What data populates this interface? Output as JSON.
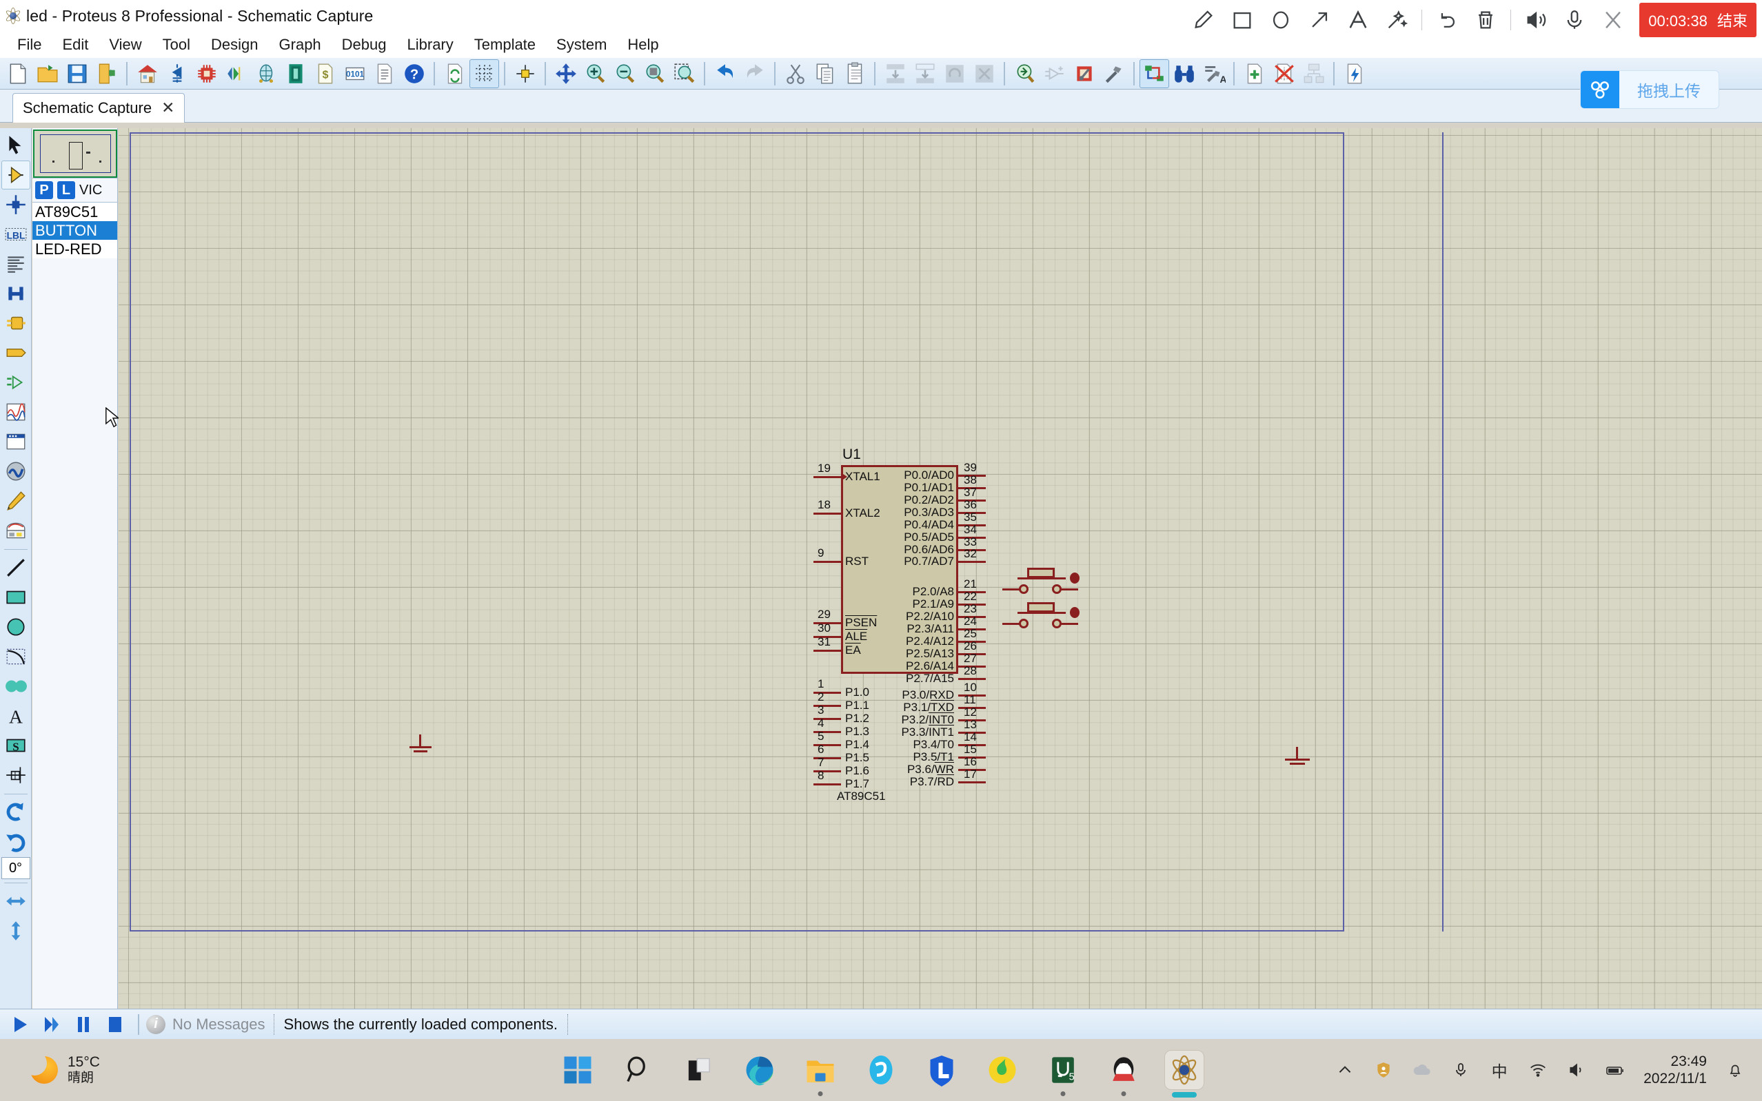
{
  "window": {
    "title": "led - Proteus 8 Professional - Schematic Capture",
    "app_icon": "proteus-atom-icon"
  },
  "menubar": {
    "items": [
      {
        "label": "File"
      },
      {
        "label": "Edit"
      },
      {
        "label": "View"
      },
      {
        "label": "Tool"
      },
      {
        "label": "Design"
      },
      {
        "label": "Graph"
      },
      {
        "label": "Debug"
      },
      {
        "label": "Library"
      },
      {
        "label": "Template"
      },
      {
        "label": "System"
      },
      {
        "label": "Help"
      }
    ]
  },
  "recorder": {
    "tools": [
      {
        "icon": "pen-icon",
        "name": "pen-tool"
      },
      {
        "icon": "rectangle-icon",
        "name": "rectangle-tool"
      },
      {
        "icon": "ellipse-icon",
        "name": "ellipse-tool"
      },
      {
        "icon": "arrow-icon",
        "name": "arrow-tool"
      },
      {
        "icon": "text-icon",
        "name": "text-tool"
      },
      {
        "icon": "magic-wand-icon",
        "name": "highlight-tool"
      },
      {
        "icon": "undo-icon",
        "name": "undo-annotation"
      },
      {
        "icon": "trash-icon",
        "name": "clear-annotations"
      },
      {
        "icon": "speaker-icon",
        "name": "system-audio-toggle"
      },
      {
        "icon": "microphone-icon",
        "name": "microphone-toggle"
      },
      {
        "icon": "close-icon",
        "name": "close-recorder"
      }
    ],
    "timer": "00:03:38",
    "stop_label": "结束"
  },
  "cloud_upload": {
    "icon": "baidu-netdisk-icon",
    "label": "拖拽上传"
  },
  "toolbar": {
    "groups": [
      {
        "buttons": [
          {
            "name": "new-project-button",
            "icon": "new-file-icon",
            "state": "enabled"
          },
          {
            "name": "open-project-button",
            "icon": "open-folder-icon",
            "state": "enabled"
          },
          {
            "name": "save-project-button",
            "icon": "floppy-save-icon",
            "state": "enabled"
          },
          {
            "name": "import-export-button",
            "icon": "door-export-icon",
            "state": "enabled"
          }
        ]
      },
      {
        "buttons": [
          {
            "name": "home-page-button",
            "icon": "house-icon",
            "state": "enabled"
          },
          {
            "name": "schematic-capture-button",
            "icon": "diode-schematic-icon",
            "state": "enabled"
          },
          {
            "name": "pcb-layout-button",
            "icon": "chip-pcb-icon",
            "state": "enabled"
          },
          {
            "name": "3d-visualizer-button",
            "icon": "3d-view-icon",
            "state": "enabled"
          },
          {
            "name": "source-code-button",
            "icon": "green-document-icon",
            "state": "enabled"
          },
          {
            "name": "bill-of-materials-button",
            "icon": "dollar-document-icon",
            "state": "enabled"
          },
          {
            "name": "bom-binary-button",
            "icon": "binary-0101-icon",
            "state": "enabled"
          },
          {
            "name": "report-button",
            "icon": "report-document-icon",
            "state": "enabled"
          },
          {
            "name": "help-button",
            "icon": "question-mark-icon",
            "state": "enabled"
          }
        ]
      },
      {
        "buttons": [
          {
            "name": "refresh-button",
            "icon": "refresh-arrows-icon",
            "state": "enabled"
          },
          {
            "name": "toggle-grid-button",
            "icon": "grid-dots-icon",
            "state": "active"
          },
          {
            "name": "set-origin-button",
            "icon": "origin-crosshair-icon",
            "state": "enabled"
          }
        ]
      },
      {
        "buttons": [
          {
            "name": "pan-button",
            "icon": "four-way-arrows-icon",
            "state": "enabled"
          },
          {
            "name": "zoom-in-button",
            "icon": "magnifier-plus-icon",
            "state": "enabled"
          },
          {
            "name": "zoom-out-button",
            "icon": "magnifier-minus-icon",
            "state": "enabled"
          },
          {
            "name": "zoom-to-fit-button",
            "icon": "magnifier-fit-icon",
            "state": "enabled"
          },
          {
            "name": "zoom-to-area-button",
            "icon": "magnifier-area-icon",
            "state": "enabled"
          }
        ]
      },
      {
        "buttons": [
          {
            "name": "undo-button",
            "icon": "undo-arrow-icon",
            "state": "enabled"
          },
          {
            "name": "redo-button",
            "icon": "redo-arrow-icon",
            "state": "disabled"
          }
        ]
      },
      {
        "buttons": [
          {
            "name": "cut-button",
            "icon": "scissors-icon",
            "state": "enabled"
          },
          {
            "name": "copy-button",
            "icon": "copy-pages-icon",
            "state": "enabled"
          },
          {
            "name": "paste-button",
            "icon": "clipboard-icon",
            "state": "enabled"
          }
        ]
      },
      {
        "buttons": [
          {
            "name": "block-copy-button",
            "icon": "block-copy-icon",
            "state": "disabled"
          },
          {
            "name": "block-move-button",
            "icon": "block-move-icon",
            "state": "disabled"
          },
          {
            "name": "block-rotate-button",
            "icon": "block-rotate-icon",
            "state": "disabled"
          },
          {
            "name": "block-delete-button",
            "icon": "block-delete-icon",
            "state": "disabled"
          }
        ]
      },
      {
        "buttons": [
          {
            "name": "pick-from-library-button",
            "icon": "library-pick-icon",
            "state": "enabled"
          },
          {
            "name": "make-device-button",
            "icon": "make-device-icon",
            "state": "disabled"
          },
          {
            "name": "packaging-tool-button",
            "icon": "packaging-wrench-icon",
            "state": "enabled"
          },
          {
            "name": "decompose-button",
            "icon": "hammer-icon",
            "state": "enabled"
          }
        ]
      },
      {
        "buttons": [
          {
            "name": "wire-autorouter-button",
            "icon": "autoroute-icon",
            "state": "active"
          },
          {
            "name": "search-and-tag-button",
            "icon": "binoculars-icon",
            "state": "enabled"
          },
          {
            "name": "property-assignment-button",
            "icon": "property-wrench-a-icon",
            "state": "enabled"
          }
        ]
      },
      {
        "buttons": [
          {
            "name": "new-sheet-button",
            "icon": "new-sheet-plus-icon",
            "state": "enabled"
          },
          {
            "name": "remove-sheet-button",
            "icon": "remove-sheet-x-icon",
            "state": "enabled"
          },
          {
            "name": "goto-sheet-button",
            "icon": "sheet-tree-icon",
            "state": "disabled"
          }
        ]
      },
      {
        "buttons": [
          {
            "name": "energy-analysis-button",
            "icon": "lightning-document-icon",
            "state": "enabled"
          }
        ]
      }
    ]
  },
  "document_tab": {
    "label": "Schematic Capture",
    "close_label": "✕"
  },
  "left_tools": {
    "items": [
      {
        "name": "selection-mode-tool",
        "icon": "arrow-cursor-icon",
        "state": "enabled"
      },
      {
        "name": "component-mode-tool",
        "icon": "yellow-triangle-component-icon",
        "state": "selected"
      },
      {
        "name": "junction-dot-tool",
        "icon": "junction-dot-icon",
        "state": "enabled"
      },
      {
        "name": "wire-label-tool",
        "icon": "lbl-label-icon",
        "state": "enabled"
      },
      {
        "name": "text-script-tool",
        "icon": "text-script-lines-icon",
        "state": "enabled"
      },
      {
        "name": "buses-tool",
        "icon": "bus-icon",
        "state": "enabled"
      },
      {
        "name": "subcircuit-tool",
        "icon": "subcircuit-icon",
        "state": "enabled"
      },
      {
        "name": "terminals-tool",
        "icon": "terminal-tag-icon",
        "state": "enabled"
      },
      {
        "name": "device-pins-tool",
        "icon": "device-pin-icon",
        "state": "enabled"
      },
      {
        "name": "graph-tool",
        "icon": "graph-waveform-icon",
        "state": "enabled"
      },
      {
        "name": "tape-recorder-tool",
        "icon": "tape-recorder-icon",
        "state": "enabled"
      },
      {
        "name": "generator-tool",
        "icon": "sine-generator-icon",
        "state": "enabled"
      },
      {
        "name": "voltage-probe-tool",
        "icon": "probe-pencil-icon",
        "state": "enabled"
      },
      {
        "name": "virtual-instruments-tool",
        "icon": "oscilloscope-icon",
        "state": "enabled"
      },
      {
        "name": "2d-line-tool",
        "icon": "line-icon",
        "state": "enabled"
      },
      {
        "name": "2d-box-tool",
        "icon": "filled-box-icon",
        "state": "enabled"
      },
      {
        "name": "2d-circle-tool",
        "icon": "filled-circle-icon",
        "state": "enabled"
      },
      {
        "name": "2d-arc-tool",
        "icon": "arc-icon",
        "state": "enabled"
      },
      {
        "name": "2d-path-tool",
        "icon": "closed-path-icon",
        "state": "enabled"
      },
      {
        "name": "2d-text-tool",
        "icon": "serif-a-icon",
        "state": "enabled"
      },
      {
        "name": "2d-symbol-tool",
        "icon": "symbol-s-icon",
        "state": "enabled"
      },
      {
        "name": "2d-marker-tool",
        "icon": "marker-crosshair-icon",
        "state": "enabled"
      },
      {
        "name": "rotate-clockwise-button",
        "icon": "rotate-cw-icon",
        "state": "enabled"
      },
      {
        "name": "rotate-counterclockwise-button",
        "icon": "rotate-ccw-icon",
        "state": "enabled"
      },
      {
        "name": "mirror-horizontal-button",
        "icon": "mirror-horizontal-icon",
        "state": "enabled"
      },
      {
        "name": "mirror-vertical-button",
        "icon": "mirror-vertical-icon",
        "state": "enabled"
      }
    ],
    "rotation_value": "0°"
  },
  "object_selector": {
    "buttons": [
      {
        "name": "pick-devices-button",
        "label": "P"
      },
      {
        "name": "library-manager-button",
        "label": "L"
      }
    ],
    "mode_label": "VIC",
    "items": [
      {
        "label": "AT89C51",
        "selected": false
      },
      {
        "label": "BUTTON",
        "selected": true
      },
      {
        "label": "LED-RED",
        "selected": false
      }
    ]
  },
  "schematic": {
    "component": {
      "reference": "U1",
      "device_name": "AT89C51",
      "left_pins": [
        {
          "num": "19",
          "label": "XTAL1",
          "overline": false,
          "clock": true
        },
        {
          "num": "18",
          "label": "XTAL2",
          "overline": false,
          "clock": false
        },
        {
          "num": "9",
          "label": "RST",
          "overline": false,
          "clock": false
        },
        {
          "num": "29",
          "label": "PSEN",
          "overline": true,
          "clock": false
        },
        {
          "num": "30",
          "label": "ALE",
          "overline": true,
          "clock": false
        },
        {
          "num": "31",
          "label": "EA",
          "overline": true,
          "clock": false
        },
        {
          "num": "1",
          "label": "P1.0",
          "overline": false,
          "clock": false
        },
        {
          "num": "2",
          "label": "P1.1",
          "overline": false,
          "clock": false
        },
        {
          "num": "3",
          "label": "P1.2",
          "overline": false,
          "clock": false
        },
        {
          "num": "4",
          "label": "P1.3",
          "overline": false,
          "clock": false
        },
        {
          "num": "5",
          "label": "P1.4",
          "overline": false,
          "clock": false
        },
        {
          "num": "6",
          "label": "P1.5",
          "overline": false,
          "clock": false
        },
        {
          "num": "7",
          "label": "P1.6",
          "overline": false,
          "clock": false
        },
        {
          "num": "8",
          "label": "P1.7",
          "overline": false,
          "clock": false
        }
      ],
      "right_pins": [
        {
          "num": "39",
          "label": "P0.0/AD0"
        },
        {
          "num": "38",
          "label": "P0.1/AD1"
        },
        {
          "num": "37",
          "label": "P0.2/AD2"
        },
        {
          "num": "36",
          "label": "P0.3/AD3"
        },
        {
          "num": "35",
          "label": "P0.4/AD4"
        },
        {
          "num": "34",
          "label": "P0.5/AD5"
        },
        {
          "num": "33",
          "label": "P0.6/AD6"
        },
        {
          "num": "32",
          "label": "P0.7/AD7"
        },
        {
          "num": "21",
          "label": "P2.0/A8"
        },
        {
          "num": "22",
          "label": "P2.1/A9"
        },
        {
          "num": "23",
          "label": "P2.2/A10"
        },
        {
          "num": "24",
          "label": "P2.3/A11"
        },
        {
          "num": "25",
          "label": "P2.4/A12"
        },
        {
          "num": "26",
          "label": "P2.5/A13"
        },
        {
          "num": "27",
          "label": "P2.6/A14"
        },
        {
          "num": "28",
          "label": "P2.7/A15"
        },
        {
          "num": "10",
          "label": "P3.0/RXD"
        },
        {
          "num": "11",
          "label": "P3.1/TXD"
        },
        {
          "num": "12",
          "label": "P3.2/INT0"
        },
        {
          "num": "13",
          "label": "P3.3/INT1"
        },
        {
          "num": "14",
          "label": "P3.4/T0"
        },
        {
          "num": "15",
          "label": "P3.5/T1"
        },
        {
          "num": "16",
          "label": "P3.6/WR"
        },
        {
          "num": "17",
          "label": "P3.7/RD"
        }
      ]
    },
    "placed_symbols": [
      {
        "name": "button-symbol-preview",
        "type": "BUTTON"
      },
      {
        "name": "button-symbol-preview-2",
        "type": "BUTTON"
      }
    ],
    "ground_symbols": 2,
    "colors": {
      "canvas": "#d8d6c4",
      "body_fill": "#cdc8a8",
      "outline": "#8a1f1f",
      "sheet_border": "#5b5fa8"
    }
  },
  "statusbar": {
    "sim_buttons": [
      {
        "name": "run-simulation-button",
        "icon": "play-icon"
      },
      {
        "name": "step-simulation-button",
        "icon": "step-icon"
      },
      {
        "name": "pause-simulation-button",
        "icon": "pause-icon"
      },
      {
        "name": "stop-simulation-button",
        "icon": "stop-icon"
      }
    ],
    "message": "No Messages",
    "hint": "Shows the currently loaded components."
  },
  "taskbar": {
    "weather": {
      "temperature": "15°C",
      "condition": "晴朗"
    },
    "apps": [
      {
        "name": "start-button",
        "icon": "windows-logo-icon",
        "state": "idle"
      },
      {
        "name": "search-button",
        "icon": "search-magnifier-icon",
        "state": "idle"
      },
      {
        "name": "task-view-button",
        "icon": "task-view-icon",
        "state": "idle"
      },
      {
        "name": "microsoft-edge-button",
        "icon": "edge-icon",
        "state": "idle"
      },
      {
        "name": "file-explorer-button",
        "icon": "folder-icon",
        "state": "open"
      },
      {
        "name": "browser-app-button",
        "icon": "blue-e-icon",
        "state": "idle"
      },
      {
        "name": "shield-app-button",
        "icon": "blue-l-shield-icon",
        "state": "idle"
      },
      {
        "name": "music-app-button",
        "icon": "qq-music-icon",
        "state": "idle"
      },
      {
        "name": "keil-uvision-button",
        "icon": "uvision5-icon",
        "state": "open"
      },
      {
        "name": "qq-messenger-button",
        "icon": "qq-penguin-icon",
        "state": "open"
      },
      {
        "name": "proteus-button",
        "icon": "proteus-atom-icon",
        "state": "active"
      }
    ],
    "tray": [
      {
        "name": "show-hidden-icons-button",
        "icon": "chevron-up-icon"
      },
      {
        "name": "security-tray-icon",
        "icon": "shield-person-icon"
      },
      {
        "name": "onedrive-tray-icon",
        "icon": "cloud-icon"
      },
      {
        "name": "microphone-tray-icon",
        "icon": "microphone-icon"
      },
      {
        "name": "ime-tray-icon",
        "icon": "chinese-ime-icon"
      },
      {
        "name": "network-tray-icon",
        "icon": "wifi-icon"
      },
      {
        "name": "volume-tray-icon",
        "icon": "speaker-icon"
      },
      {
        "name": "battery-tray-icon",
        "icon": "battery-icon"
      }
    ],
    "clock": {
      "time": "23:49",
      "date": "2022/11/1"
    },
    "notification_icon": "notification-bell-icon"
  }
}
